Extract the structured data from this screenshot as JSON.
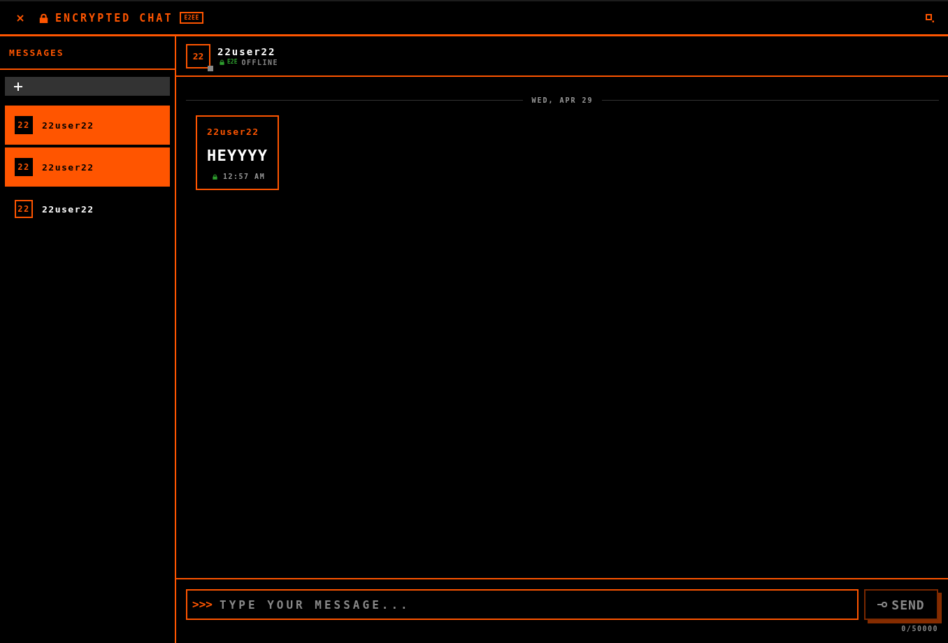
{
  "header": {
    "title": "ENCRYPTED CHAT",
    "badge": "E2EE"
  },
  "sidebar": {
    "title": "MESSAGES",
    "conversations": [
      {
        "avatar": "22",
        "name": "22user22",
        "selected": true
      },
      {
        "avatar": "22",
        "name": "22user22",
        "selected": true
      },
      {
        "avatar": "22",
        "name": "22user22",
        "selected": false
      }
    ]
  },
  "chat": {
    "avatar": "22",
    "name": "22user22",
    "online": false,
    "encryption": "E2E",
    "status": "OFFLINE"
  },
  "messages": {
    "date": "WED, APR 29",
    "items": [
      {
        "sender": "22user22",
        "text": "HEYYYY",
        "time": "12:57 AM",
        "encrypted": true
      }
    ]
  },
  "composer": {
    "prompt": ">>>",
    "placeholder": "TYPE YOUR MESSAGE...",
    "send_label": "SEND",
    "send_disabled": true,
    "counter": "0/50000"
  }
}
